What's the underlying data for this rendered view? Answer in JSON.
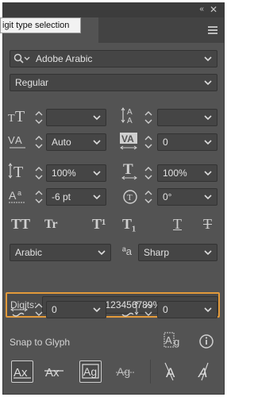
{
  "window": {
    "collapse_glyph": "‹‹",
    "close_glyph": "✕"
  },
  "tooltip": {
    "text": "igit type selection"
  },
  "font_family": {
    "value": "Adobe Arabic"
  },
  "font_style": {
    "value": "Regular"
  },
  "size": {
    "value": ""
  },
  "leading": {
    "value": ""
  },
  "kerning": {
    "value": "Auto"
  },
  "tracking": {
    "value": "0"
  },
  "vertical_scale": {
    "value": "100%"
  },
  "horizontal_scale": {
    "value": "100%"
  },
  "baseline_shift": {
    "value": "-6 pt"
  },
  "rotation": {
    "value": "0°"
  },
  "type_buttons": {
    "all_caps": "TT",
    "small_caps": "Tr",
    "superscript": "T¹",
    "subscript": "T₁",
    "underline": "T",
    "strikethrough": "T"
  },
  "language": {
    "value": "Arabic"
  },
  "aa_glyph": "ªa",
  "anti_alias": {
    "value": "Sharp"
  },
  "digits": {
    "label": "Digits:",
    "value": "LTR Arabic (0123456789%)"
  },
  "diacritic_x": {
    "value": "0"
  },
  "diacritic_y": {
    "value": "0"
  },
  "snap": {
    "label": "Snap to Glyph"
  },
  "colors": {
    "panel": "#535353",
    "field": "#454545",
    "highlight": "#e39a3a",
    "text": "#e2e2e2"
  },
  "icons": [
    "search-icon",
    "chevron-down-icon",
    "font-size-icon",
    "leading-icon",
    "kerning-icon",
    "tracking-icon",
    "vertical-scale-icon",
    "horizontal-scale-icon",
    "baseline-shift-icon",
    "rotate-icon",
    "glyph-preview-icon",
    "info-icon",
    "panel-menu-icon"
  ]
}
